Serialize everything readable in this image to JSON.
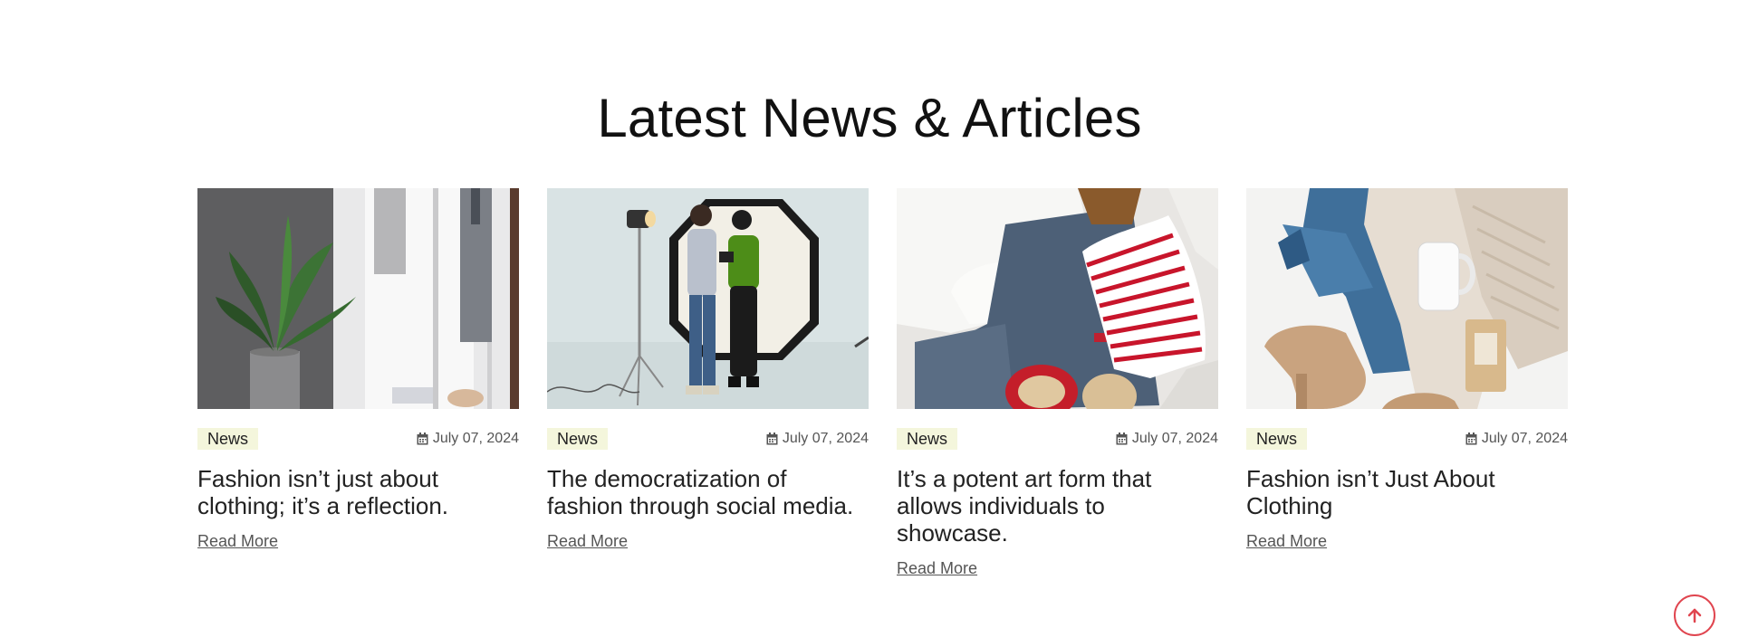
{
  "section": {
    "title": "Latest News & Articles"
  },
  "articles": [
    {
      "category": "News",
      "date": "July 07, 2024",
      "title": "Fashion isn’t just about clothing; it’s a reflection.",
      "read_more": "Read More",
      "image_icon": "interior-plant-curtain-photo"
    },
    {
      "category": "News",
      "date": "July 07, 2024",
      "title": "The democratization of fashion through social media.",
      "read_more": "Read More",
      "image_icon": "photo-studio-couple-photo"
    },
    {
      "category": "News",
      "date": "July 07, 2024",
      "title": "It’s a potent art form that allows individuals to showcase.",
      "read_more": "Read More",
      "image_icon": "clothes-flatlay-jeans-photo"
    },
    {
      "category": "News",
      "date": "July 07, 2024",
      "title": "Fashion isn’t Just About Clothing",
      "read_more": "Read More",
      "image_icon": "sweater-boots-flatlay-photo"
    }
  ],
  "colors": {
    "tag_bg": "#f4f6dc",
    "accent": "#e0454f"
  },
  "icons": {
    "date": "calendar-icon",
    "scroll_top": "arrow-up-icon"
  }
}
